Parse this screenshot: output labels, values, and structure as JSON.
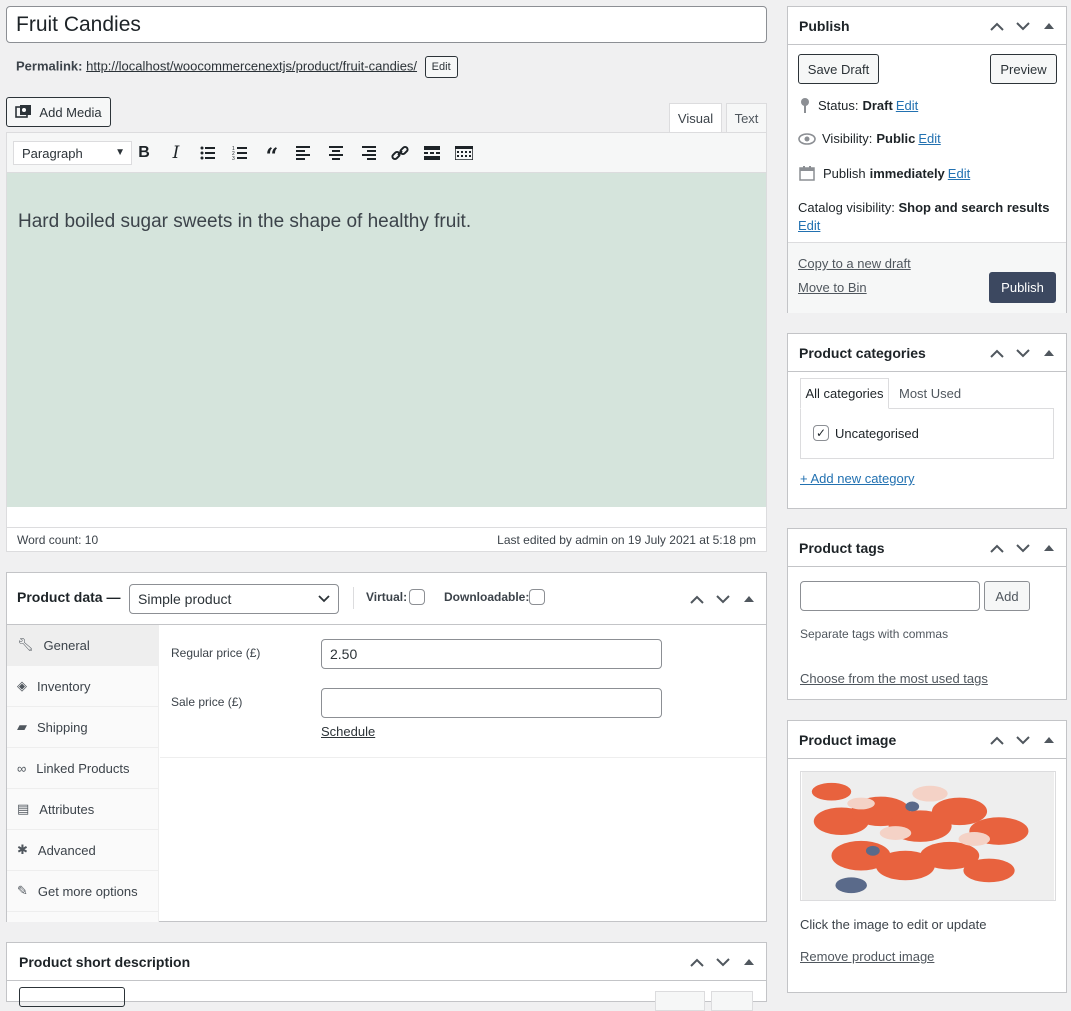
{
  "title": {
    "value": "Fruit Candies"
  },
  "permalink": {
    "label": "Permalink:",
    "url": "http://localhost/woocommercenextjs/product/fruit-candies/",
    "edit_label": "Edit"
  },
  "editor": {
    "add_media_label": "Add Media",
    "tabs": [
      "Visual",
      "Text"
    ],
    "format_select": "Paragraph",
    "content": "Hard boiled sugar sweets in the shape of healthy fruit.",
    "word_count": "Word count: 10",
    "last_edited": "Last edited by admin on 19 July 2021 at 5:18 pm",
    "toolbar_icons": [
      "bold-icon",
      "italic-icon",
      "bullet-list-icon",
      "numbered-list-icon",
      "blockquote-icon",
      "align-left-icon",
      "align-center-icon",
      "align-right-icon",
      "link-icon",
      "read-more-icon",
      "toolbar-toggle-icon"
    ]
  },
  "product_data": {
    "title": "Product data —",
    "type_select": "Simple product",
    "virtual_label": "Virtual:",
    "downloadable_label": "Downloadable:",
    "tabs": [
      {
        "label": "General",
        "icon": "wrench-icon"
      },
      {
        "label": "Inventory",
        "icon": "tag-icon"
      },
      {
        "label": "Shipping",
        "icon": "truck-icon"
      },
      {
        "label": "Linked Products",
        "icon": "link-icon"
      },
      {
        "label": "Attributes",
        "icon": "list-icon"
      },
      {
        "label": "Advanced",
        "icon": "gear-icon"
      },
      {
        "label": "Get more options",
        "icon": "plugin-icon"
      }
    ],
    "regular_price_label": "Regular price (£)",
    "regular_price_value": "2.50",
    "sale_price_label": "Sale price (£)",
    "sale_price_value": "",
    "schedule_label": "Schedule"
  },
  "short_description": {
    "title": "Product short description"
  },
  "publish": {
    "title": "Publish",
    "save_draft": "Save Draft",
    "preview": "Preview",
    "status_label": "Status:",
    "status_value": "Draft",
    "visibility_label": "Visibility:",
    "visibility_value": "Public",
    "publish_label": "Publish",
    "publish_value": "immediately",
    "catalog_label": "Catalog visibility:",
    "catalog_value": "Shop and search results",
    "edit_label": "Edit",
    "copy_draft": "Copy to a new draft",
    "move_bin": "Move to Bin",
    "publish_button": "Publish",
    "publish_button_color": "#3c4860"
  },
  "categories": {
    "title": "Product categories",
    "tab_all": "All categories",
    "tab_most_used": "Most Used",
    "items": [
      {
        "label": "Uncategorised",
        "checked": true
      }
    ],
    "add_new": "+ Add new category"
  },
  "tags": {
    "title": "Product tags",
    "input_value": "",
    "add_button": "Add",
    "hint": "Separate tags with commas",
    "choose_link": "Choose from the most used tags"
  },
  "product_image": {
    "title": "Product image",
    "hint": "Click the image to edit or update",
    "remove_link": "Remove product image"
  },
  "colors": {
    "editor_bg": "#d5e4dc",
    "accent": "#2271b1",
    "publish_bg": "#3c4860"
  }
}
